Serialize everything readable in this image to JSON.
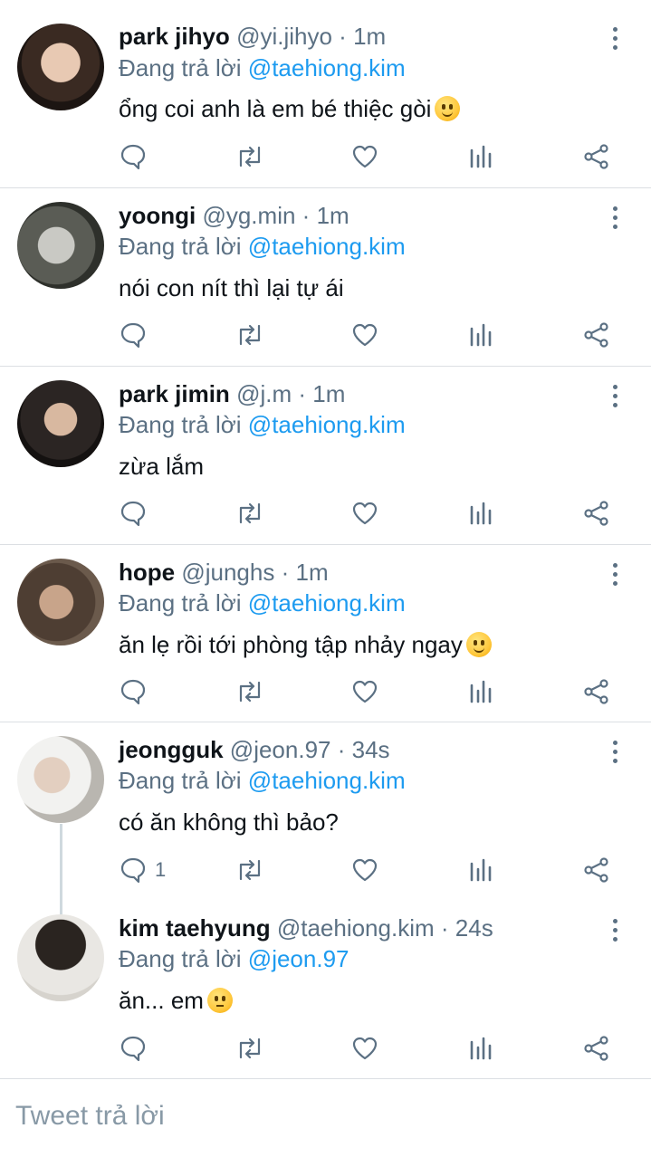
{
  "reply_prefix": "Đang trả lời",
  "tweets": [
    {
      "name": "park jihyo",
      "handle": "@yi.jihyo",
      "separator": "·",
      "time": "1m",
      "reply_to": "@taehiong.kim",
      "text": "ổng coi anh là em bé thiệc gòi",
      "emoji": "slightly-smiling-face",
      "reply_count": ""
    },
    {
      "name": "yoongi",
      "handle": "@yg.min",
      "separator": "·",
      "time": "1m",
      "reply_to": "@taehiong.kim",
      "text": "nói con nít thì lại tự ái",
      "emoji": "",
      "reply_count": ""
    },
    {
      "name": "park jimin",
      "handle": "@j.m",
      "separator": "·",
      "time": "1m",
      "reply_to": "@taehiong.kim",
      "text": "zừa lắm",
      "emoji": "",
      "reply_count": ""
    },
    {
      "name": "hope",
      "handle": "@junghs",
      "separator": "·",
      "time": "1m",
      "reply_to": "@taehiong.kim",
      "text": "ăn lẹ rồi tới phòng tập nhảy ngay",
      "emoji": "slightly-smiling-face",
      "reply_count": ""
    },
    {
      "name": "jeongguk",
      "handle": "@jeon.97",
      "separator": "·",
      "time": "34s",
      "reply_to": "@taehiong.kim",
      "text": "có ăn không thì bảo?",
      "emoji": "",
      "reply_count": "1"
    },
    {
      "name": "kim taehyung",
      "handle": "@taehiong.kim",
      "separator": "·",
      "time": "24s",
      "reply_to": "@jeon.97",
      "text": "ăn... em",
      "emoji": "neutral-face",
      "reply_count": ""
    }
  ],
  "composer": {
    "placeholder": "Tweet trả lời"
  },
  "colors": {
    "accent": "#1d9bf0",
    "secondary_text": "#5b7083",
    "primary_text": "#0f1419",
    "divider": "#dcdfe3"
  }
}
